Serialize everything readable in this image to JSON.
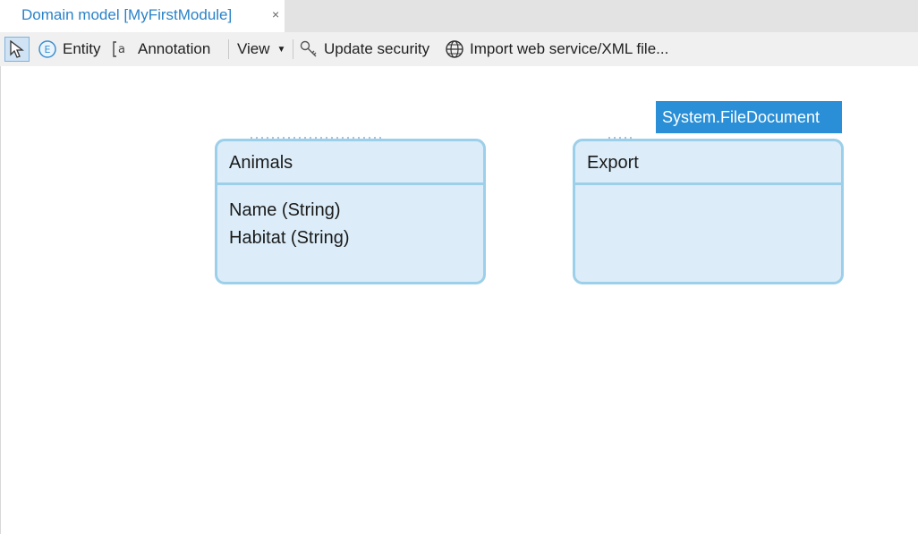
{
  "tab": {
    "title": "Domain model [MyFirstModule]",
    "close": "×"
  },
  "toolbar": {
    "entity_label": "Entity",
    "annotation_label": "Annotation",
    "view_label": "View",
    "update_security_label": "Update security",
    "import_label": "Import web service/XML file..."
  },
  "entities": [
    {
      "name": "Animals",
      "attributes": [
        "Name (String)",
        "Habitat (String)"
      ]
    },
    {
      "name": "Export",
      "attributes": [],
      "generalization": "System.FileDocument"
    }
  ],
  "colors": {
    "accent": "#2a82c8",
    "entity_fill": "#dcedf9",
    "entity_border": "#9ccfe9",
    "generalization_bg": "#2a8fd6"
  }
}
